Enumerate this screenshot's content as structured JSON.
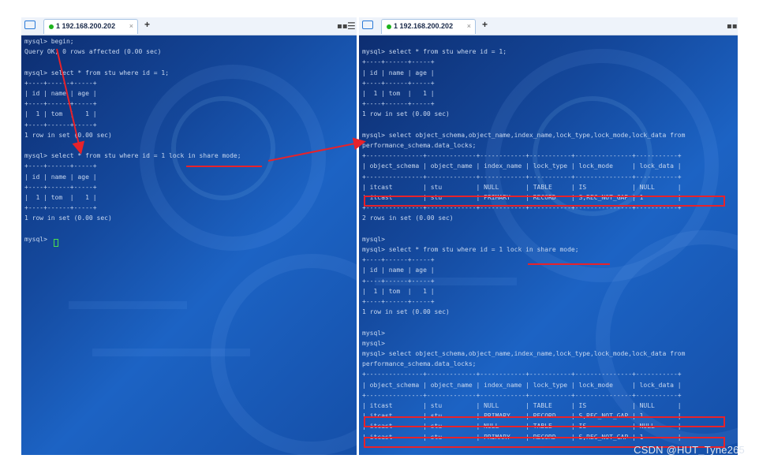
{
  "tabs": {
    "folder_icon": "folder-icon",
    "left": {
      "label": "1 192.168.200.202",
      "close": "×",
      "add": "+"
    },
    "right": {
      "label": "1 192.168.200.202",
      "close": "×",
      "add": "+"
    }
  },
  "colors": {
    "status_dot": "#1db31d",
    "highlight": "#e8222a",
    "terminal_bg": "#14489c"
  },
  "left_terminal": {
    "lines": [
      "mysql> begin;",
      "Query OK, 0 rows affected (0.00 sec)",
      "",
      "mysql> select * from stu where id = 1;",
      "+----+------+-----+",
      "| id | name | age |",
      "+----+------+-----+",
      "|  1 | tom  |   1 |",
      "+----+------+-----+",
      "1 row in set (0.00 sec)",
      "",
      "mysql> select * from stu where id = 1 lock in share mode;",
      "+----+------+-----+",
      "| id | name | age |",
      "+----+------+-----+",
      "|  1 | tom  |   1 |",
      "+----+------+-----+",
      "1 row in set (0.00 sec)",
      "",
      "mysql> "
    ]
  },
  "right_terminal": {
    "lines": [
      "",
      "mysql> select * from stu where id = 1;",
      "+----+------+-----+",
      "| id | name | age |",
      "+----+------+-----+",
      "|  1 | tom  |   1 |",
      "+----+------+-----+",
      "1 row in set (0.00 sec)",
      "",
      "mysql> select object_schema,object_name,index_name,lock_type,lock_mode,lock_data from",
      "performance_schema.data_locks;",
      "+---------------+-------------+------------+-----------+---------------+-----------+",
      "| object_schema | object_name | index_name | lock_type | lock_mode     | lock_data |",
      "+---------------+-------------+------------+-----------+---------------+-----------+",
      "| itcast        | stu         | NULL       | TABLE     | IS            | NULL      |",
      "| itcast        | stu         | PRIMARY    | RECORD    | S,REC_NOT_GAP | 1         |",
      "+---------------+-------------+------------+-----------+---------------+-----------+",
      "2 rows in set (0.00 sec)",
      "",
      "mysql>",
      "mysql> select * from stu where id = 1 lock in share mode;",
      "+----+------+-----+",
      "| id | name | age |",
      "+----+------+-----+",
      "|  1 | tom  |   1 |",
      "+----+------+-----+",
      "1 row in set (0.00 sec)",
      "",
      "mysql>",
      "mysql>",
      "mysql> select object_schema,object_name,index_name,lock_type,lock_mode,lock_data from",
      "performance_schema.data_locks;",
      "+---------------+-------------+------------+-----------+---------------+-----------+",
      "| object_schema | object_name | index_name | lock_type | lock_mode     | lock_data |",
      "+---------------+-------------+------------+-----------+---------------+-----------+",
      "| itcast        | stu         | NULL       | TABLE     | IS            | NULL      |",
      "| itcast        | stu         | PRIMARY    | RECORD    | S,REC_NOT_GAP | 1         |",
      "| itcast        | stu         | NULL       | TABLE     | IS            | NULL      |",
      "| itcast        | stu         | PRIMARY    | RECORD    | S,REC_NOT_GAP | 1         |"
    ]
  },
  "watermark": "CSDN @HUT_Tyne265"
}
